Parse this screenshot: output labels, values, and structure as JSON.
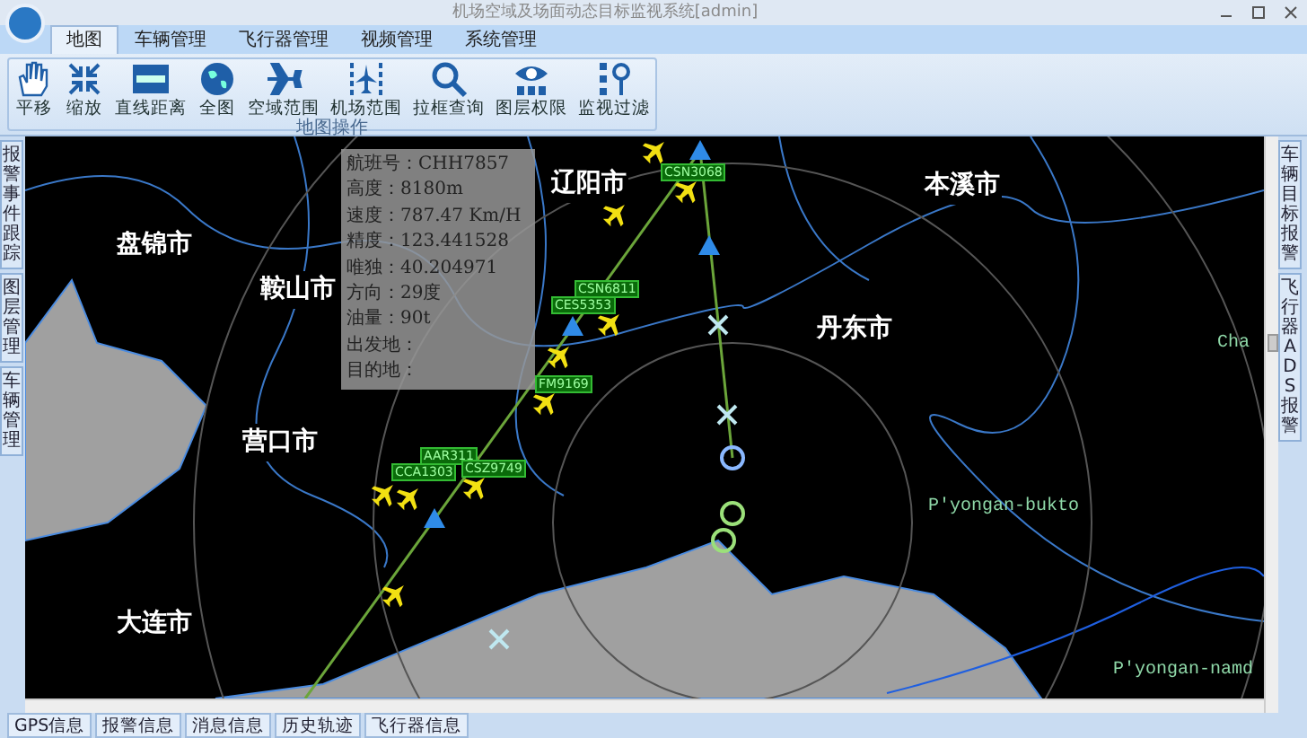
{
  "window": {
    "title": "机场空域及场面动态目标监视系统[admin]"
  },
  "menu_tabs": [
    {
      "label": "地图",
      "selected": true
    },
    {
      "label": "车辆管理",
      "selected": false
    },
    {
      "label": "飞行器管理",
      "selected": false
    },
    {
      "label": "视频管理",
      "selected": false
    },
    {
      "label": "系统管理",
      "selected": false
    }
  ],
  "ribbon": {
    "buttons": [
      {
        "label": "平移",
        "kind": "pan"
      },
      {
        "label": "缩放",
        "kind": "zoom"
      },
      {
        "label": "直线距离",
        "kind": "measure"
      },
      {
        "label": "全图",
        "kind": "globe"
      },
      {
        "label": "空域范围",
        "kind": "airspace"
      },
      {
        "label": "机场范围",
        "kind": "airport"
      },
      {
        "label": "拉框查询",
        "kind": "search"
      },
      {
        "label": "图层权限",
        "kind": "layers"
      },
      {
        "label": "监视过滤",
        "kind": "filter"
      }
    ],
    "group_label": "地图操作"
  },
  "left_tabs": [
    "报警事件跟踪",
    "图层管理",
    "车辆管理"
  ],
  "right_tabs": [
    "车辆目标报警",
    "飞行器ADS报警"
  ],
  "map": {
    "cities": [
      "盘锦市",
      "鞍山市",
      "辽阳市",
      "本溪市",
      "丹东市",
      "营口市",
      "大连市"
    ],
    "region_labels": [
      "Cha",
      "P'yongan-bukto",
      "P'yongan-namd"
    ],
    "flight_tags": [
      "CSN3068",
      "CSN6811",
      "CES5353",
      "FM9169",
      "AAR311",
      "CCA1303",
      "CSZ9749"
    ],
    "info_panel": [
      "航班号：CHH7857",
      "高度：8180m",
      "速度：787.47 Km/H",
      "精度：123.441528",
      "唯独：40.204971",
      "方向：29度",
      "油量：90t",
      "出发地：",
      "目的地："
    ]
  },
  "bottom_tabs": [
    {
      "label": "GPS信息",
      "selected": false
    },
    {
      "label": "报警信息",
      "selected": false
    },
    {
      "label": "消息信息",
      "selected": false
    },
    {
      "label": "历史轨迹",
      "selected": false
    },
    {
      "label": "飞行器信息",
      "selected": false
    }
  ]
}
